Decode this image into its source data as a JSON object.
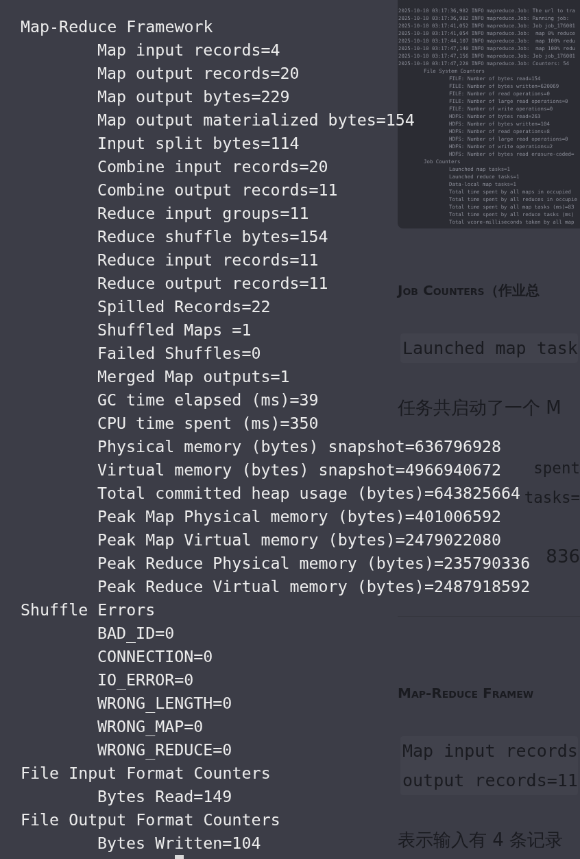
{
  "document": {
    "blocks": [
      {
        "kind": "screenshot",
        "log_lines": [
          {
            "text": "2025-10-10 03:17:36,982 INFO mapreduce.Job: The url to tra"
          },
          {
            "text": "2025-10-10 03:17:36,982 INFO mapreduce.Job: Running job:"
          },
          {
            "text": "2025-10-10 03:17:41,052 INFO mapreduce.Job: Job job_176001"
          },
          {
            "text": "2025-10-10 03:17:41,054 INFO mapreduce.Job:  map 0% reduce"
          },
          {
            "text": "2025-10-10 03:17:44,107 INFO mapreduce.Job:  map 100% redu"
          },
          {
            "text": "2025-10-10 03:17:47,140 INFO mapreduce.Job:  map 100% redu"
          },
          {
            "text": "2025-10-10 03:17:47,156 INFO mapreduce.Job: Job job_176001"
          },
          {
            "text": "2025-10-10 03:17:47,228 INFO mapreduce.Job: Counters: 54",
            "children": [
              {
                "text": "File System Counters",
                "children": [
                  {
                    "text": "FILE: Number of bytes read=154"
                  },
                  {
                    "text": "FILE: Number of bytes written=620069"
                  },
                  {
                    "text": "FILE: Number of read operations=0"
                  },
                  {
                    "text": "FILE: Number of large read operations=0"
                  },
                  {
                    "text": "FILE: Number of write operations=0"
                  },
                  {
                    "text": "HDFS: Number of bytes read=263"
                  },
                  {
                    "text": "HDFS: Number of bytes written=104"
                  },
                  {
                    "text": "HDFS: Number of read operations=8"
                  },
                  {
                    "text": "HDFS: Number of large read operations=0"
                  },
                  {
                    "text": "HDFS: Number of write operations=2"
                  },
                  {
                    "text": "HDFS: Number of bytes read erasure-coded="
                  }
                ]
              },
              {
                "text": "Job Counters",
                "children": [
                  {
                    "text": "Launched map tasks=1"
                  },
                  {
                    "text": "Launched reduce tasks=1"
                  },
                  {
                    "text": "Data-local map tasks=1"
                  },
                  {
                    "text": "Total time spent by all maps in occupied"
                  },
                  {
                    "text": "Total time spent by all reduces in occupie"
                  },
                  {
                    "text": "Total time spent by all map tasks (ms)=83"
                  },
                  {
                    "text": "Total time spent by all reduce tasks (ms)"
                  },
                  {
                    "text": "Total vcore-milliseconds taken by all map"
                  }
                ]
              }
            ]
          }
        ]
      },
      {
        "kind": "heading",
        "text": "Job Counters（作业总"
      },
      {
        "kind": "code",
        "lines": [
          "Launched map task"
        ]
      },
      {
        "kind": "paragraph",
        "text": "任务共启动了一个 M"
      },
      {
        "kind": "code_fragment",
        "lines": [
          "spent",
          "tasks="
        ]
      },
      {
        "kind": "paragraph_fragment",
        "text": "836"
      },
      {
        "kind": "rule"
      },
      {
        "kind": "heading",
        "text": "Map-Reduce Framew"
      },
      {
        "kind": "code",
        "lines": [
          "Map input records",
          "output records=11"
        ]
      },
      {
        "kind": "paragraph",
        "text": "表示输入有 4 条记录"
      }
    ]
  },
  "terminal": {
    "sections": [
      {
        "title": "Map-Reduce Framework",
        "items": [
          "Map input records=4",
          "Map output records=20",
          "Map output bytes=229",
          "Map output materialized bytes=154",
          "Input split bytes=114",
          "Combine input records=20",
          "Combine output records=11",
          "Reduce input groups=11",
          "Reduce shuffle bytes=154",
          "Reduce input records=11",
          "Reduce output records=11",
          "Spilled Records=22",
          "Shuffled Maps =1",
          "Failed Shuffles=0",
          "Merged Map outputs=1",
          "GC time elapsed (ms)=39",
          "CPU time spent (ms)=350",
          "Physical memory (bytes) snapshot=636796928",
          "Virtual memory (bytes) snapshot=4966940672",
          "Total committed heap usage (bytes)=643825664",
          "Peak Map Physical memory (bytes)=401006592",
          "Peak Map Virtual memory (bytes)=2479022080",
          "Peak Reduce Physical memory (bytes)=235790336",
          "Peak Reduce Virtual memory (bytes)=2487918592"
        ]
      },
      {
        "title": "Shuffle Errors",
        "items": [
          "BAD_ID=0",
          "CONNECTION=0",
          "IO_ERROR=0",
          "WRONG_LENGTH=0",
          "WRONG_MAP=0",
          "WRONG_REDUCE=0"
        ]
      },
      {
        "title": "File Input Format Counters",
        "items": [
          "Bytes Read=149"
        ]
      },
      {
        "title": "File Output Format Counters",
        "items": [
          "Bytes Written=104"
        ]
      }
    ],
    "cursor": true
  }
}
